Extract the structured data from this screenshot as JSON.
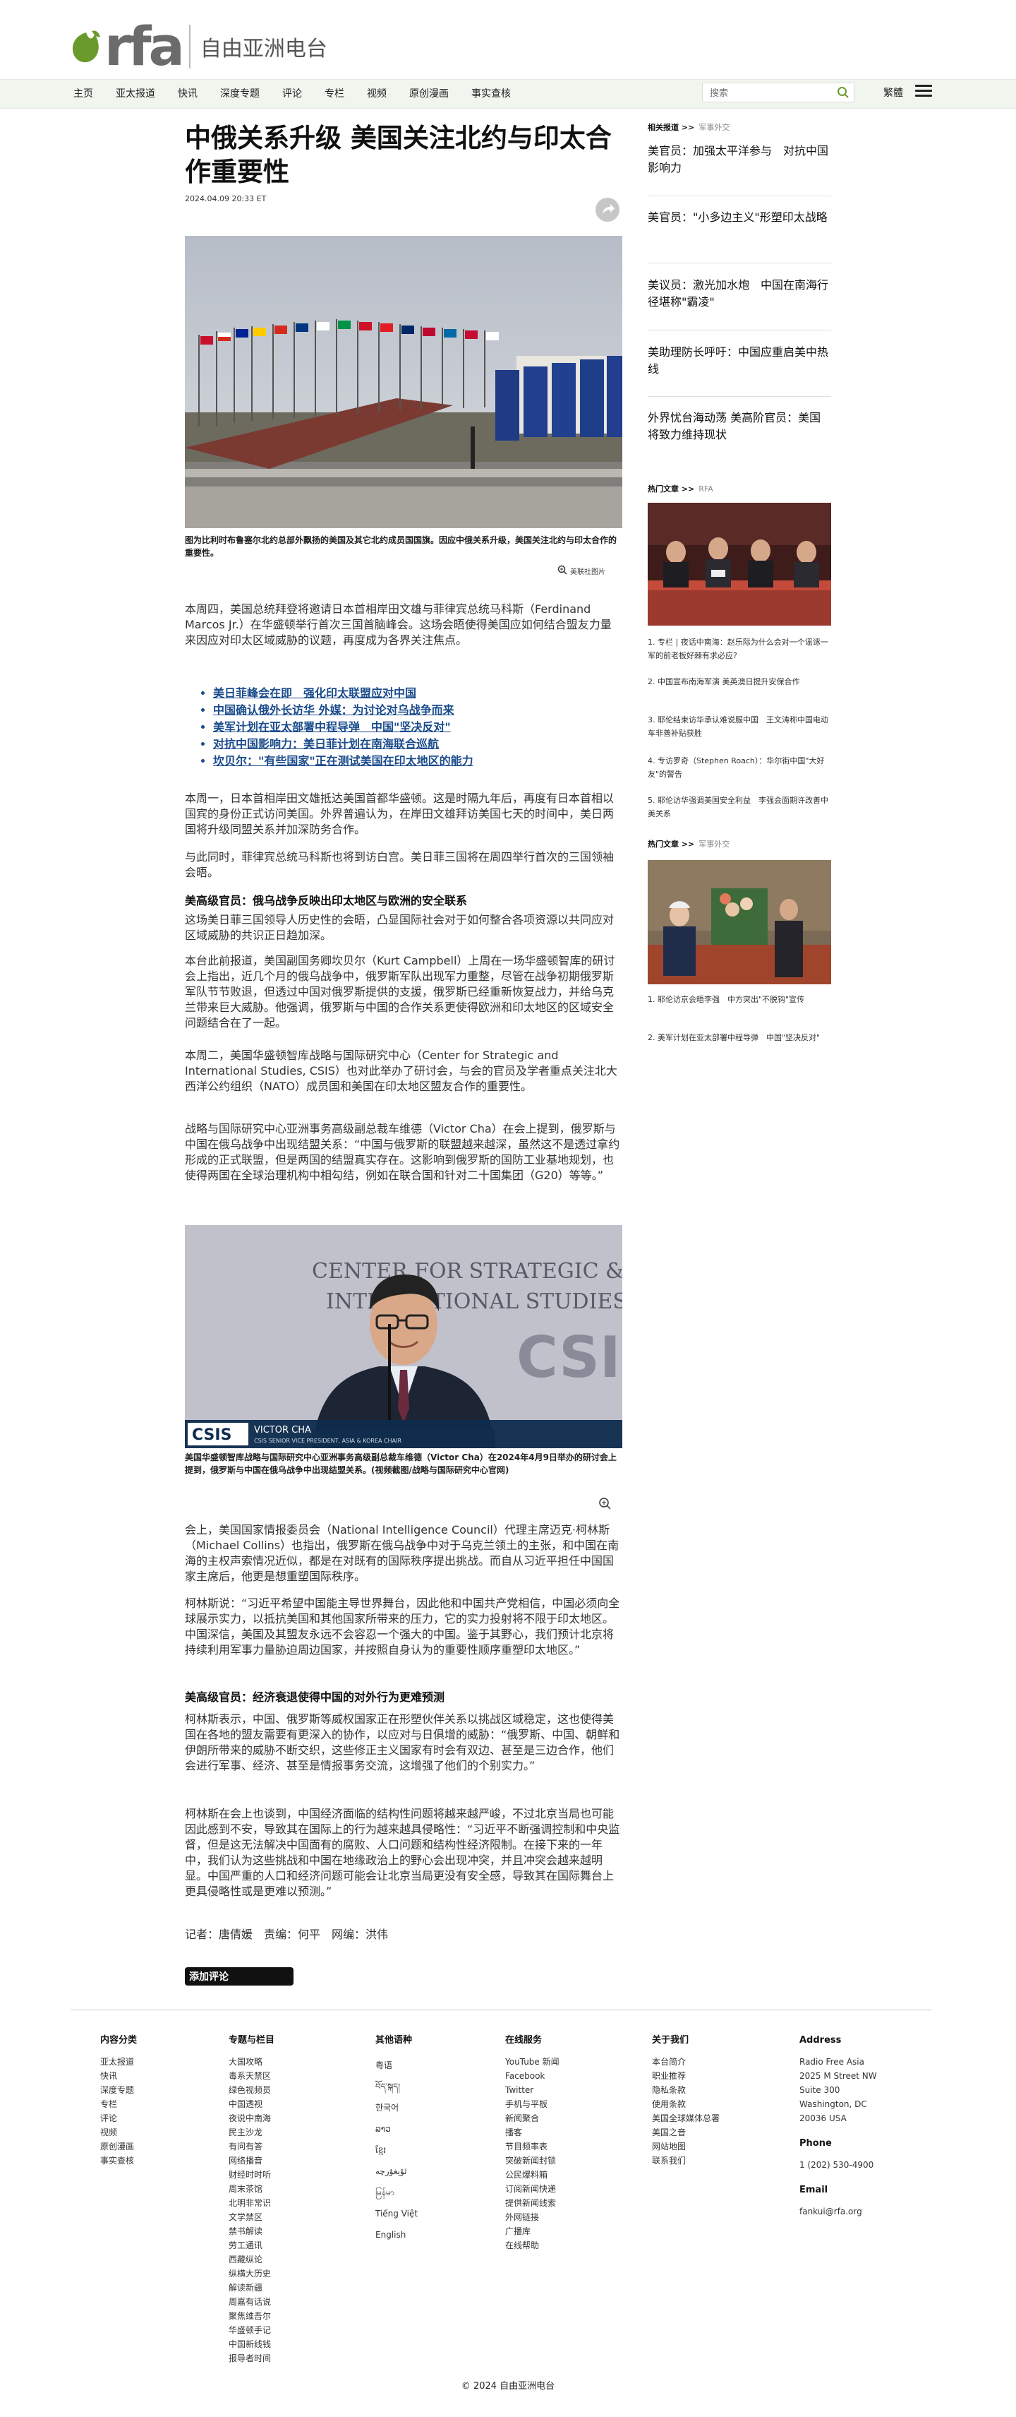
{
  "site": {
    "logo_text": "rfa",
    "logo_cn": "自由亚洲电台",
    "brand_color": "#6a9a2b"
  },
  "nav": {
    "items": [
      "主页",
      "亚太报道",
      "快讯",
      "深度专题",
      "评论",
      "专栏",
      "视频",
      "原创漫画",
      "事实查核"
    ],
    "search_placeholder": "搜索",
    "lang_label": "繁體"
  },
  "article": {
    "title": "中俄关系升级 美国关注北约与印太合作重要性",
    "date": "2024.04.09 20:33 ET",
    "caption1": "图为比利时布鲁塞尔北约总部外飘扬的美国及其它北约成员国国旗。因应中俄关系升级，美国关注北约与印太合作的重要性。",
    "credit1": "美联社图片",
    "p1": "本周四，美国总统拜登将邀请日本首相岸田文雄与菲律宾总统马科斯（Ferdinand Marcos Jr.）在华盛顿举行首次三国首脑峰会。这场会晤使得美国应如何结合盟友力量来因应对印太区域威胁的议题，再度成为各界关注焦点。",
    "related": [
      "美日菲峰会在即　强化印太联盟应对中国",
      "中国确认俄外长访华 外媒：为讨论对乌战争而来",
      "美军计划在亚太部署中程导弹　中国\"坚决反对\"",
      "对抗中国影响力：美日菲计划在南海联合巡航",
      "坎贝尔：\"有些国家\"正在测试美国在印太地区的能力"
    ],
    "p2": "本周一，日本首相岸田文雄抵达美国首都华盛顿。这是时隔九年后，再度有日本首相以国宾的身份正式访问美国。外界普遍认为，在岸田文雄拜访美国七天的时间中，美日两国将升级同盟关系并加深防务合作。",
    "p3": "与此同时，菲律宾总统马科斯也将到访白宫。美日菲三国将在周四举行首次的三国领袖会晤。",
    "h2a": "美高级官员：俄乌战争反映出印太地区与欧洲的安全联系",
    "p4": "这场美日菲三国领导人历史性的会晤，凸显国际社会对于如何整合各项资源以共同应对区域威胁的共识正日趋加深。",
    "p5": "本台此前报道，美国副国务卿坎贝尔（Kurt Campbell）上周在一场华盛顿智库的研讨会上指出，近几个月的俄乌战争中，俄罗斯军队出现军力重整，尽管在战争初期俄罗斯军队节节败退，但透过中国对俄罗斯提供的支援，俄罗斯已经重新恢复战力，并给乌克兰带来巨大威胁。他强调，俄罗斯与中国的合作关系更使得欧洲和印太地区的区域安全问题结合在了一起。",
    "p6": "本周二，美国华盛顿智库战略与国际研究中心（Center for Strategic and International Studies, CSIS）也对此举办了研讨会，与会的官员及学者重点关注北大西洋公约组织（NATO）成员国和美国在印太地区盟友合作的重要性。",
    "p7": "战略与国际研究中心亚洲事务高级副总裁车维德（Victor Cha）在会上提到，俄罗斯与中国在俄乌战争中出现结盟关系：“中国与俄罗斯的联盟越来越深，虽然这不是透过拿约形成的正式联盟，但是两国的结盟真实存在。这影响到俄罗斯的国防工业基地规划，也使得两国在全球治理机构中相勾结，例如在联合国和针对二十国集团（G20）等等。”",
    "photo2_overlay_brand": "CSIS",
    "photo2_overlay_name": "VICTOR CHA",
    "photo2_overlay_title": "CSIS SENIOR VICE PRESIDENT, ASIA & KOREA CHAIR",
    "photo2_bg_text1": "CENTER FOR STRATEGIC &",
    "photo2_bg_text2": "INTERNATIONAL STUDIES",
    "caption2": "美国华盛顿智库战略与国际研究中心亚洲事务高级副总裁车维德（Victor Cha）在2024年4月9日举办的研讨会上提到，俄罗斯与中国在俄乌战争中出现结盟关系。(视频截图/战略与国际研究中心官网)",
    "p8": "会上，美国国家情报委员会（National Intelligence Council）代理主席迈克·柯林斯（Michael Collins）也指出，俄罗斯在俄乌战争中对于乌克兰领土的主张，和中国在南海的主权声索情况近似，都是在对既有的国际秩序提出挑战。而自从习近平担任中国国家主席后，他更是想重塑国际秩序。",
    "p9": "柯林斯说：“习近平希望中国能主导世界舞台，因此他和中国共产党相信，中国必须向全球展示实力，以抵抗美国和其他国家所带来的压力，它的实力投射将不限于印太地区。中国深信，美国及其盟友永远不会容忍一个强大的中国。鉴于其野心，我们预计北京将持续利用军事力量胁迫周边国家，并按照自身认为的重要性顺序重塑印太地区。”",
    "h2b": "美高级官员：经济衰退使得中国的对外行为更难预测",
    "p10": "柯林斯表示，中国、俄罗斯等威权国家正在形塑伙伴关系以挑战区域稳定，这也使得美国在各地的盟友需要有更深入的协作，以应对与日俱增的威胁：“俄罗斯、中国、朝鲜和伊朗所带来的威胁不断交织，这些修正主义国家有时会有双边、甚至是三边合作，他们会进行军事、经济、甚至是情报事务交流，这增强了他们的个别实力。”",
    "p11": "柯林斯在会上也谈到，中国经济面临的结构性问题将越来越严峻，不过北京当局也可能因此感到不安，导致其在国际上的行为越来越具侵略性：“习近平不断强调控制和中央监督，但是这无法解决中国面有的腐败、人口问题和结构性经济限制。在接下来的一年中，我们认为这些挑战和中国在地缘政治上的野心会出现冲突，并且冲突会越来越明显。中国严重的人口和经济问题可能会让北京当局更没有安全感，导致其在国际舞台上更具侵略性或是更难以预测。”",
    "byline": "记者：唐倩媛　责编：何平　网编：洪伟",
    "comment_label": "添加评论"
  },
  "sidebar": {
    "related_label": "相关报道 >>",
    "related_sub": "军事外交",
    "related_links": [
      "美官员：加强太平洋参与　对抗中国影响力",
      "美官员：\"小多边主义\"形塑印太战略",
      "美议员：激光加水炮　中国在南海行径堪称\"霸凌\"",
      "美助理防长呼吁：中国应重启美中热线",
      "外界忧台海动荡 美高阶官员：美国将致力维持现状"
    ],
    "hot_label": "热门文章 >>",
    "hot_sub": "RFA",
    "hot_items": [
      "1. 专栏 | 夜话中南海：赵乐际为什么会对一个谣诼一军的前老板好棘有求必应?",
      "2. 中国宣布南海军演 美英澳日提升安保合作",
      "3. 耶伦结束访华承认难说服中国　王文涛称中国电动车非善补贴获胜",
      "4. 专访罗奇（Stephen Roach）：华尔街中国\"大好友\"的警告",
      "5. 耶伦访华强调美国安全利益　李强会面期许改善中美关系"
    ],
    "hot2_label": "热门文章 >>",
    "hot2_sub": "军事外交",
    "hot2_items": [
      "1. 耶伦访京会晤李强　中方突出\"不脱钩\"宣传",
      "2. 美军计划在亚太部署中程导弹　中国\"坚决反对\""
    ]
  },
  "footer": {
    "col1_title": "内容分类",
    "col1": [
      "亚太报道",
      "快讯",
      "深度专题",
      "专栏",
      "评论",
      "视频",
      "原创漫画",
      "事实查核"
    ],
    "col2_title": "专题与栏目",
    "col2": [
      "大国攻略",
      "毒系天禁区",
      "绿色视频员",
      "中国透视",
      "夜说中南海",
      "民主沙龙",
      "有问有答",
      "网络播音",
      "财经时时听",
      "周末茶馆",
      "北明非常识",
      "文学禁区",
      "禁书解读",
      "劳工通讯",
      "西藏纵论",
      "纵横大历史",
      "解读新疆",
      "周嘉有话说",
      "聚焦维吾尔",
      "华盛顿手记",
      "中国新线钱",
      "报导者时间"
    ],
    "col3_title": "其他语种",
    "col3": [
      "粤语",
      "བོད་སྐད།",
      "한국어",
      "ລາວ",
      "ខ្មែរ",
      "ئۇيغۇرچە",
      "မြန်မာ",
      "Tiếng Việt",
      "English"
    ],
    "col4_title": "在线服务",
    "col4": [
      "YouTube 新闻",
      "Facebook",
      "Twitter",
      "手机与平板",
      "新闻聚合",
      "播客",
      "节目频率表",
      "突破新闻封锁",
      "公民爆料箱",
      "订阅新闻快递",
      "提供新闻线索",
      "外网链接",
      "广播库",
      "在线帮助"
    ],
    "col5_title": "关于我们",
    "col5": [
      "本台简介",
      "职业推荐",
      "隐私条款",
      "使用条款",
      "美国全球媒体总署",
      "美国之音",
      "网站地图",
      "联系我们"
    ],
    "address_title": "Address",
    "address": [
      "Radio Free Asia",
      "2025 M Street NW",
      "Suite 300",
      "Washington, DC",
      "20036 USA"
    ],
    "phone_title": "Phone",
    "phone": "1 (202) 530-4900",
    "email_title": "Email",
    "email": "fankui@rfa.org",
    "copyright": "© 2024 自由亚洲电台"
  }
}
